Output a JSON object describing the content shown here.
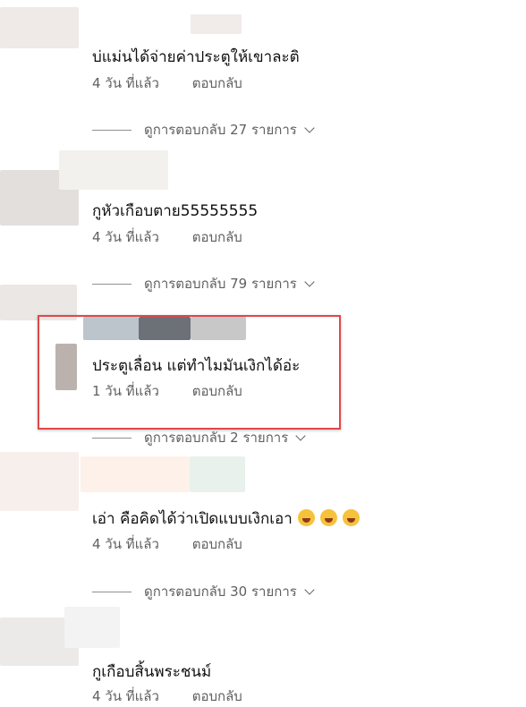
{
  "comments": [
    {
      "text": "บ่แม่นได้จ่ายค่าประตูให้เขาละติ",
      "time": "4 วัน ที่แล้ว",
      "reply": "ตอบกลับ",
      "replies": "ดูการตอบกลับ 27 รายการ"
    },
    {
      "text": "กูหัวเกือบตาย55555555",
      "time": "4 วัน ที่แล้ว",
      "reply": "ตอบกลับ",
      "replies": "ดูการตอบกลับ 79 รายการ"
    },
    {
      "text": "ประตูเลื่อน แต่ทำไมมันเงิกได้อ่ะ",
      "time": "1 วัน ที่แล้ว",
      "reply": "ตอบกลับ",
      "replies": "ดูการตอบกลับ 2 รายการ"
    },
    {
      "text": "เอ่า คือคิดได้ว่าเปิดแบบเงิกเอา",
      "emoji": [
        "laughing-emoji",
        "laughing-emoji",
        "laughing-emoji"
      ],
      "time": "4 วัน ที่แล้ว",
      "reply": "ตอบกลับ",
      "replies": "ดูการตอบกลับ 30 รายการ"
    },
    {
      "text": "กูเกือบสิ้นพระชนม์",
      "time": "4 วัน ที่แล้ว",
      "reply": "ตอบกลับ"
    }
  ],
  "colors": {
    "highlight": "#e04848",
    "secondary_text": "#606060"
  }
}
